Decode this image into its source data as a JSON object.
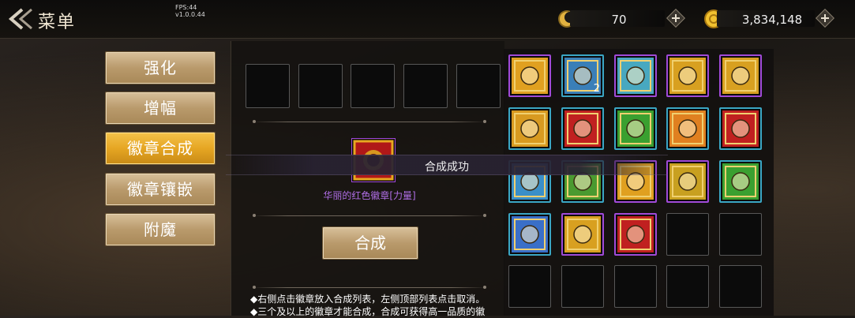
{
  "header": {
    "title": "菜单",
    "fps": "FPS:44",
    "version": "v1.0.0.44",
    "currency_a": {
      "icon": "moon-coin-icon",
      "value": "70"
    },
    "currency_b": {
      "icon": "gold-coin-icon",
      "value": "3,834,148"
    }
  },
  "menu": [
    {
      "label": "强化",
      "active": false
    },
    {
      "label": "增幅",
      "active": false
    },
    {
      "label": "徽章合成",
      "active": true
    },
    {
      "label": "徽章镶嵌",
      "active": false
    },
    {
      "label": "附魔",
      "active": false
    }
  ],
  "compose": {
    "result_name": "华丽的红色徽章[力量]",
    "button_label": "合成",
    "tip1": "◆右侧点击徽章放入合成列表，左侧顶部列表点击取消。",
    "tip2": "◆三个及以上的徽章才能合成，合成可获得高一品质的徽"
  },
  "toast": {
    "text": "合成成功"
  },
  "badges": [
    {
      "icon": "gold-figure-badge-icon",
      "color": "#e0a020",
      "count": ""
    },
    {
      "icon": "blue-target-badge-icon",
      "color": "#3a7fb8",
      "count": "2"
    },
    {
      "icon": "cyan-target-badge-icon",
      "color": "#48a8c0",
      "count": ""
    },
    {
      "icon": "red-gold-crown-badge-icon",
      "color": "#d8a020",
      "count": ""
    },
    {
      "icon": "silver-face-badge-icon",
      "color": "#d8a020",
      "count": ""
    },
    {
      "icon": "gold-figure-badge-icon",
      "color": "#d89a20",
      "count": ""
    },
    {
      "icon": "red-eye-badge-icon",
      "color": "#c02020",
      "count": ""
    },
    {
      "icon": "green-heart-badge-icon",
      "color": "#3aa030",
      "count": ""
    },
    {
      "icon": "orange-heart-badge-icon",
      "color": "#e08020",
      "count": ""
    },
    {
      "icon": "red-eye-badge-icon",
      "color": "#c02020",
      "count": ""
    },
    {
      "icon": "blue-gear-badge-icon",
      "color": "#3a8fc8",
      "count": ""
    },
    {
      "icon": "green-gear-badge-icon",
      "color": "#4a9a30",
      "count": ""
    },
    {
      "icon": "gold-heart-badge-icon",
      "color": "#e0a020",
      "count": ""
    },
    {
      "icon": "green-gold-cross-badge-icon",
      "color": "#c8a020",
      "count": ""
    },
    {
      "icon": "green-target-badge-icon",
      "color": "#3aa030",
      "count": ""
    },
    {
      "icon": "blue-shield-badge-icon",
      "color": "#3a6fc8",
      "count": ""
    },
    {
      "icon": "gold-sword-badge-icon",
      "color": "#d8a020",
      "count": ""
    },
    {
      "icon": "red-gold-orb-badge-icon",
      "color": "#c02020",
      "count": ""
    }
  ]
}
